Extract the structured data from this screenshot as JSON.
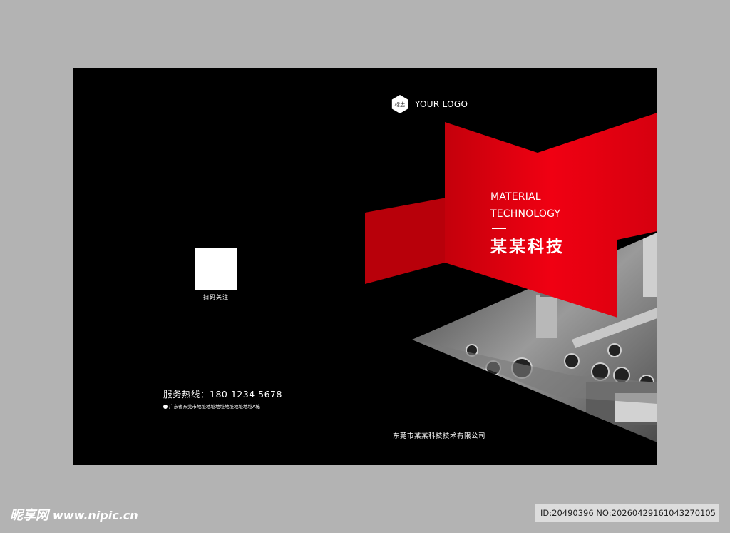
{
  "back_cover": {
    "qr_label": "扫码关注",
    "hotline": "服务热线：180 1234 5678",
    "address": "广东省东莞市地址地址地址地址地址地址A栋"
  },
  "front_cover": {
    "logo_mark": "标志",
    "logo_text": "YOUR LOGO",
    "title_en_line1": "MATERIAL",
    "title_en_line2": "TECHNOLOGY",
    "title_cn": "某某科技",
    "company": "东莞市某某科技技术有限公司"
  },
  "colors": {
    "accent": "#e30011",
    "background": "#000000",
    "page": "#b3b3b3"
  },
  "watermark": {
    "brand": "昵享网",
    "url": "www.nipic.cn",
    "id_text": "ID:20490396 NO:20260429161043270105"
  }
}
